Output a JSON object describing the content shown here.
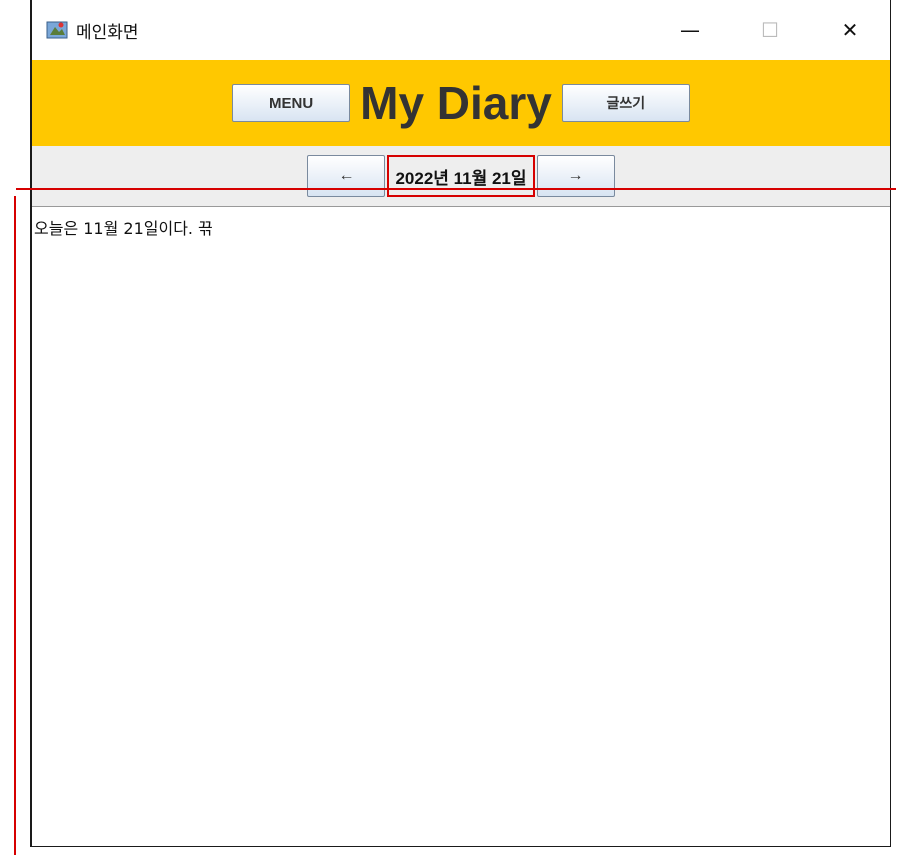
{
  "window": {
    "title": "메인화면",
    "controls": {
      "minimize": "—",
      "maximize": "☐",
      "close": "✕"
    }
  },
  "header": {
    "menu_label": "MENU",
    "app_title": "My Diary",
    "write_label": "글쓰기",
    "background": "#ffc800"
  },
  "nav": {
    "prev_label": "←",
    "date": "2022년 11월 21일",
    "next_label": "→"
  },
  "content": {
    "text": "오늘은 11월 21일이다. 끆"
  },
  "colors": {
    "highlight": "#d60000"
  }
}
